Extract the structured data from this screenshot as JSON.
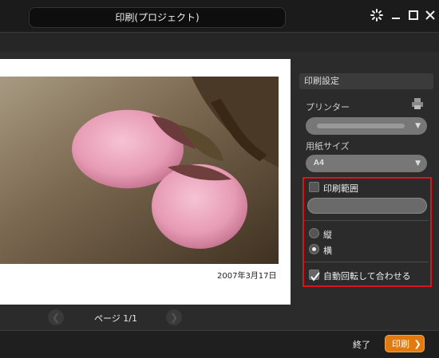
{
  "window": {
    "title": "印刷(プロジェクト)"
  },
  "preview": {
    "date_stamp": "2007年3月17日"
  },
  "pager": {
    "prev": "❮",
    "next": "❯",
    "text": "ページ 1/1"
  },
  "settings": {
    "header": "印刷設定",
    "printer_label": "プリンター",
    "paper_label": "用紙サイズ",
    "paper_value": "A4",
    "range_label": "印刷範囲",
    "orientation": {
      "portrait": "縦",
      "landscape": "横",
      "selected": "横"
    },
    "auto_rotate_label": "自動回転して合わせる",
    "auto_rotate_checked": true,
    "range_checked": false
  },
  "footer": {
    "end_label": "終了",
    "print_label": "印刷"
  },
  "colors": {
    "accent": "#e27a10",
    "highlight_box": "#d8141c"
  },
  "icons": [
    "settings-burst-icon",
    "minimize-icon",
    "maximize-icon",
    "close-icon",
    "printer-icon",
    "chevron-down-icon",
    "check-icon",
    "chevron-right-icon"
  ]
}
